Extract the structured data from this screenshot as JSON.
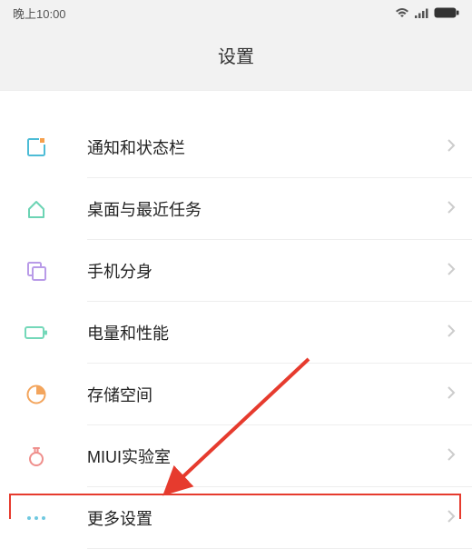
{
  "status_bar": {
    "time": "晚上10:00"
  },
  "header": {
    "title": "设置"
  },
  "items": [
    {
      "label": "通知和状态栏"
    },
    {
      "label": "桌面与最近任务"
    },
    {
      "label": "手机分身"
    },
    {
      "label": "电量和性能"
    },
    {
      "label": "存储空间"
    },
    {
      "label": "MIUI实验室"
    },
    {
      "label": "更多设置"
    }
  ]
}
